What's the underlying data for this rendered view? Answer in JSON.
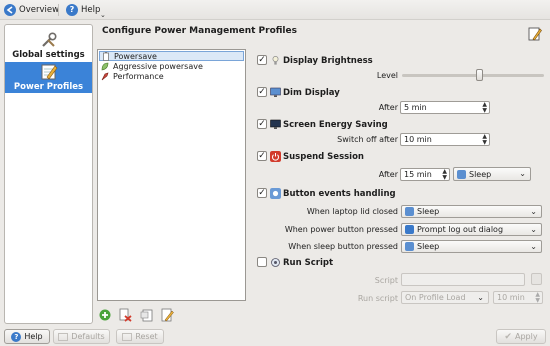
{
  "toolbar": {
    "overview_label": "Overview",
    "help_label": "Help"
  },
  "sidebar": {
    "items": [
      {
        "label": "Global settings",
        "icon": "tools-icon"
      },
      {
        "label": "Power Profiles",
        "icon": "notepad-pencil-icon",
        "selected": true
      }
    ]
  },
  "main": {
    "title": "Configure Power Management Profiles",
    "profiles": [
      {
        "label": "Powersave",
        "selected": true
      },
      {
        "label": "Aggressive powersave"
      },
      {
        "label": "Performance"
      }
    ],
    "sections": {
      "display_brightness": {
        "title": "Display Brightness",
        "checked": true,
        "level_label": "Level",
        "level_fraction": 0.55
      },
      "dim_display": {
        "title": "Dim Display",
        "checked": true,
        "after_label": "After",
        "after_value": "5 min"
      },
      "screen_energy": {
        "title": "Screen Energy Saving",
        "checked": true,
        "switch_label": "Switch off after",
        "switch_value": "10 min"
      },
      "suspend": {
        "title": "Suspend Session",
        "checked": true,
        "after_label": "After",
        "after_value": "15 min",
        "mode": "Sleep"
      },
      "button_events": {
        "title": "Button events handling",
        "checked": true,
        "lid_label": "When laptop lid closed",
        "lid_value": "Sleep",
        "power_label": "When power button pressed",
        "power_value": "Prompt log out dialog",
        "sleep_label": "When sleep button pressed",
        "sleep_value": "Sleep"
      },
      "run_script": {
        "title": "Run Script",
        "checked": false,
        "script_label": "Script",
        "script_value": "",
        "run_label": "Run script",
        "run_value": "On Profile Load",
        "time_value": "10 min"
      }
    }
  },
  "footer": {
    "help_label": "Help",
    "defaults_label": "Defaults",
    "reset_label": "Reset",
    "apply_label": "Apply"
  },
  "colors": {
    "selection": "#3b83d8",
    "background": "#eceae7",
    "accent_red": "#d23b2c"
  }
}
